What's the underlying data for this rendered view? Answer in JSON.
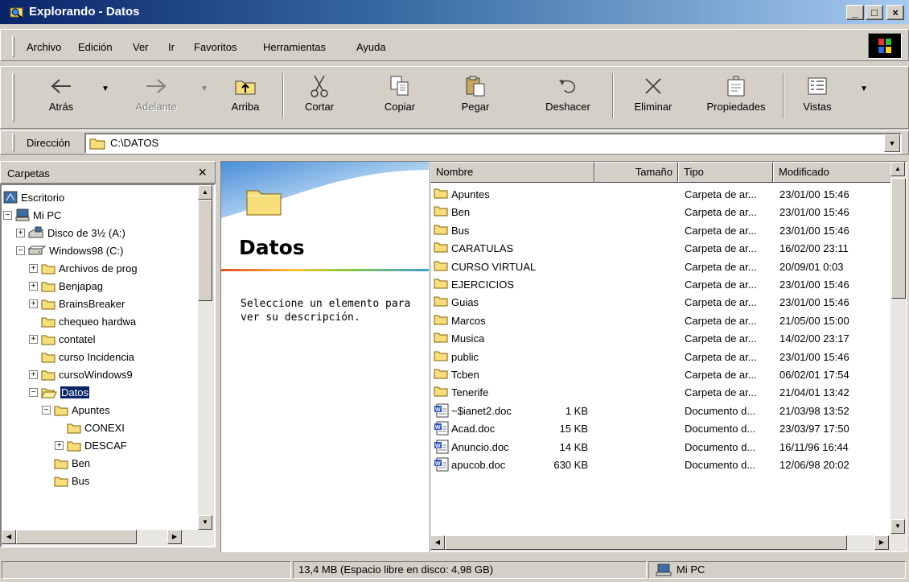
{
  "window": {
    "title": "Explorando - Datos",
    "buttons": {
      "minimize": "_",
      "maximize": "□",
      "close": "×"
    }
  },
  "menu": [
    {
      "label": "Archivo"
    },
    {
      "label": "Edición"
    },
    {
      "label": "Ver"
    },
    {
      "label": "Ir"
    },
    {
      "label": "Favoritos"
    },
    {
      "label": "Herramientas"
    },
    {
      "label": "Ayuda"
    }
  ],
  "toolbar": {
    "back": "Atrás",
    "forward": "Adelante",
    "up": "Arriba",
    "cut": "Cortar",
    "copy": "Copiar",
    "paste": "Pegar",
    "undo": "Deshacer",
    "delete": "Eliminar",
    "properties": "Propiedades",
    "views": "Vistas"
  },
  "address": {
    "label": "Dirección",
    "value": "C:\\DATOS"
  },
  "folders_pane": {
    "title": "Carpetas",
    "close": "×",
    "tree": [
      {
        "label": "Escritorio",
        "icon": "desktop-icon",
        "level": 0,
        "expander": ""
      },
      {
        "label": "Mi PC",
        "icon": "computer-icon",
        "level": 0,
        "expander": "−"
      },
      {
        "label": "Disco de 3½ (A:)",
        "icon": "floppy-icon",
        "level": 1,
        "expander": "+"
      },
      {
        "label": "Windows98 (C:)",
        "icon": "harddisk-icon",
        "level": 1,
        "expander": "−"
      },
      {
        "label": "Archivos de prog",
        "icon": "folder-icon",
        "level": 2,
        "expander": "+"
      },
      {
        "label": "Benjapag",
        "icon": "folder-icon",
        "level": 2,
        "expander": "+"
      },
      {
        "label": "BrainsBreaker",
        "icon": "folder-icon",
        "level": 2,
        "expander": "+"
      },
      {
        "label": "chequeo hardwa",
        "icon": "folder-icon",
        "level": 2,
        "expander": ""
      },
      {
        "label": "contatel",
        "icon": "folder-icon",
        "level": 2,
        "expander": "+"
      },
      {
        "label": "curso Incidencia",
        "icon": "folder-icon",
        "level": 2,
        "expander": ""
      },
      {
        "label": "cursoWindows9",
        "icon": "folder-icon",
        "level": 2,
        "expander": "+"
      },
      {
        "label": "Datos",
        "icon": "open-folder-icon",
        "level": 2,
        "expander": "−",
        "selected": true
      },
      {
        "label": "Apuntes",
        "icon": "folder-icon",
        "level": 3,
        "expander": "−"
      },
      {
        "label": "CONEXI",
        "icon": "folder-icon",
        "level": 4,
        "expander": ""
      },
      {
        "label": "DESCAF",
        "icon": "folder-icon",
        "level": 4,
        "expander": "+"
      },
      {
        "label": "Ben",
        "icon": "folder-icon",
        "level": 3,
        "expander": ""
      },
      {
        "label": "Bus",
        "icon": "folder-icon",
        "level": 3,
        "expander": ""
      }
    ]
  },
  "webview": {
    "title": "Datos",
    "description": "Seleccione un elemento para ver su descripción."
  },
  "file_list": {
    "columns": [
      "Nombre",
      "Tamaño",
      "Tipo",
      "Modificado"
    ],
    "rows": [
      {
        "name": "Apuntes",
        "size": "",
        "type": "Carpeta de ar...",
        "modified": "23/01/00 15:46",
        "icon": "folder-icon"
      },
      {
        "name": "Ben",
        "size": "",
        "type": "Carpeta de ar...",
        "modified": "23/01/00 15:46",
        "icon": "folder-icon"
      },
      {
        "name": "Bus",
        "size": "",
        "type": "Carpeta de ar...",
        "modified": "23/01/00 15:46",
        "icon": "folder-icon"
      },
      {
        "name": "CARATULAS",
        "size": "",
        "type": "Carpeta de ar...",
        "modified": "16/02/00 23:11",
        "icon": "folder-icon"
      },
      {
        "name": "CURSO VIRTUAL",
        "size": "",
        "type": "Carpeta de ar...",
        "modified": "20/09/01 0:03",
        "icon": "folder-icon"
      },
      {
        "name": "EJERCICIOS",
        "size": "",
        "type": "Carpeta de ar...",
        "modified": "23/01/00 15:46",
        "icon": "folder-icon"
      },
      {
        "name": "Guias",
        "size": "",
        "type": "Carpeta de ar...",
        "modified": "23/01/00 15:46",
        "icon": "folder-icon"
      },
      {
        "name": "Marcos",
        "size": "",
        "type": "Carpeta de ar...",
        "modified": "21/05/00 15:00",
        "icon": "folder-icon"
      },
      {
        "name": "Musica",
        "size": "",
        "type": "Carpeta de ar...",
        "modified": "14/02/00 23:17",
        "icon": "folder-icon"
      },
      {
        "name": "public",
        "size": "",
        "type": "Carpeta de ar...",
        "modified": "23/01/00 15:46",
        "icon": "folder-icon"
      },
      {
        "name": "Tcben",
        "size": "",
        "type": "Carpeta de ar...",
        "modified": "06/02/01 17:54",
        "icon": "folder-icon"
      },
      {
        "name": "Tenerife",
        "size": "",
        "type": "Carpeta de ar...",
        "modified": "21/04/01 13:42",
        "icon": "folder-icon"
      },
      {
        "name": "~$ianet2.doc",
        "size": "1 KB",
        "type": "Documento d...",
        "modified": "21/03/98 13:52",
        "icon": "word-doc-icon"
      },
      {
        "name": "Acad.doc",
        "size": "15 KB",
        "type": "Documento d...",
        "modified": "23/03/97 17:50",
        "icon": "word-doc-icon"
      },
      {
        "name": "Anuncio.doc",
        "size": "14 KB",
        "type": "Documento d...",
        "modified": "16/11/96 16:44",
        "icon": "word-doc-icon"
      },
      {
        "name": "apucob.doc",
        "size": "630 KB",
        "type": "Documento d...",
        "modified": "12/06/98 20:02",
        "icon": "word-doc-icon"
      }
    ]
  },
  "status": {
    "left": "",
    "disk": "13,4 MB (Espacio libre en disco: 4,98 GB)",
    "location": "Mi PC"
  },
  "colors": {
    "title_start": "#0a246a",
    "title_end": "#a6caf0",
    "selection": "#0a246a",
    "face": "#d4d0c8",
    "folder": "#f7de7b"
  }
}
